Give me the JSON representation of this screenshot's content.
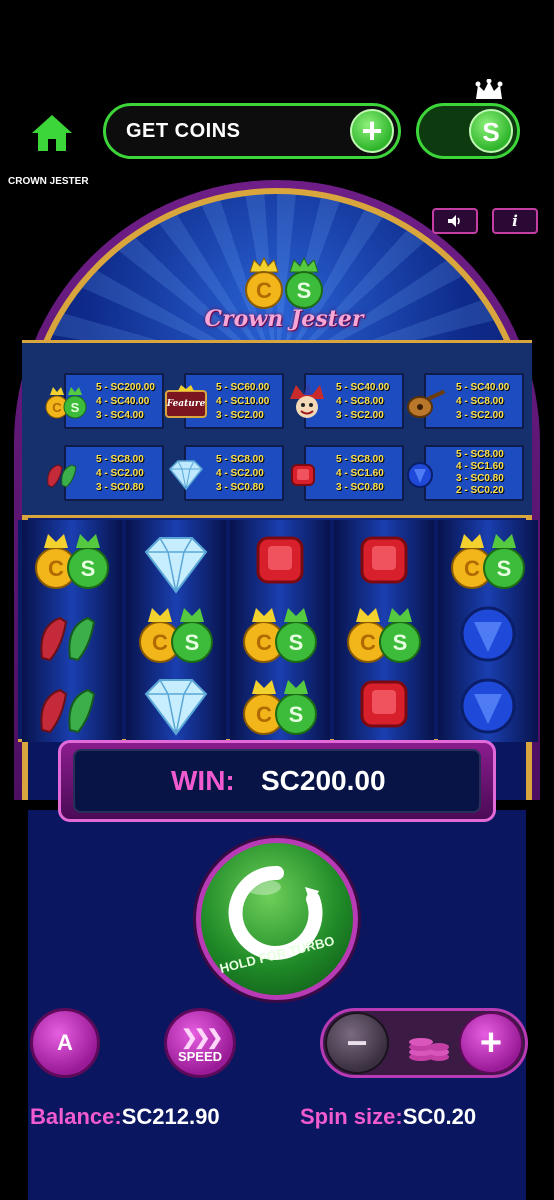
{
  "topbar": {
    "get_coins_label": "GET COINS",
    "plus_label": "+",
    "currency_toggle_label": "S"
  },
  "game": {
    "title": "CROWN JESTER",
    "logo_text": "Crown Jester",
    "info_label": "i"
  },
  "paytable": [
    {
      "symbol": "coin-crowns",
      "lines": [
        "5 - SC200.00",
        "4 - SC40.00",
        "3 - SC4.00"
      ]
    },
    {
      "symbol": "feature-chest",
      "lines": [
        "5 - SC60.00",
        "4 - SC10.00",
        "3 - SC2.00"
      ]
    },
    {
      "symbol": "jester",
      "lines": [
        "5 - SC40.00",
        "4 - SC8.00",
        "3 - SC2.00"
      ]
    },
    {
      "symbol": "lute",
      "lines": [
        "5 - SC40.00",
        "4 - SC8.00",
        "3 - SC2.00"
      ]
    },
    {
      "symbol": "jester-shoes",
      "lines": [
        "5 - SC8.00",
        "4 - SC2.00",
        "3 - SC0.80"
      ]
    },
    {
      "symbol": "diamond",
      "lines": [
        "5 - SC8.00",
        "4 - SC2.00",
        "3 - SC0.80"
      ]
    },
    {
      "symbol": "ruby",
      "lines": [
        "5 - SC8.00",
        "4 - SC1.60",
        "3 - SC0.80"
      ]
    },
    {
      "symbol": "sapphire",
      "lines": [
        "5 - SC8.00",
        "4 - SC1.60",
        "3 - SC0.80",
        "2 - SC0.20"
      ]
    }
  ],
  "paytable_feature_label": "Feature",
  "reels": [
    [
      "coin-crowns",
      "jester-shoes",
      "jester-shoes"
    ],
    [
      "diamond",
      "coin-crowns",
      "diamond"
    ],
    [
      "ruby",
      "coin-crowns",
      "coin-crowns"
    ],
    [
      "ruby",
      "coin-crowns",
      "ruby"
    ],
    [
      "coin-crowns",
      "sapphire",
      "sapphire"
    ]
  ],
  "win": {
    "label": "WIN:",
    "value": "SC200.00"
  },
  "spin": {
    "label": "HOLD FOR TURBO"
  },
  "controls": {
    "auto_label": "A",
    "speed_label": "SPEED",
    "minus_label": "−",
    "plus_label": "+"
  },
  "footer": {
    "balance_label": "Balance:",
    "balance_value": "SC212.90",
    "spin_size_label": "Spin size:",
    "spin_size_value": "SC0.20"
  },
  "colors": {
    "accent_green": "#3dd63a",
    "accent_pink": "#f25ad0",
    "gold": "#d8a63c",
    "paytable_text": "#ffe24a"
  }
}
